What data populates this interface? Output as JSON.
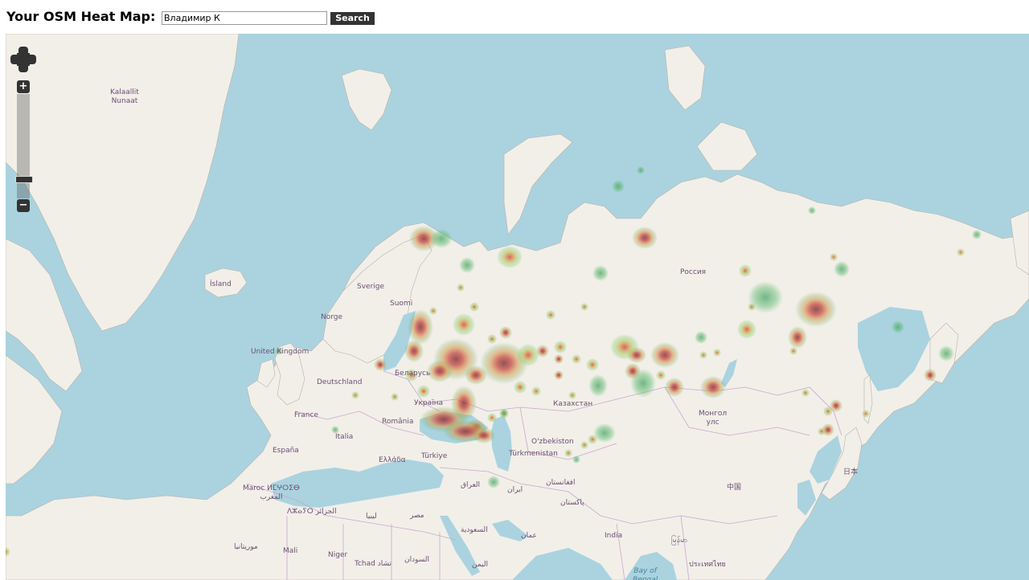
{
  "header": {
    "title": "Your OSM Heat Map:",
    "username_value": "Владимир К",
    "search_label": "Search"
  },
  "map": {
    "controls": {
      "zoom_in_label": "+",
      "zoom_out_label": "−",
      "zoom_level_fraction": 0.85
    },
    "labels": [
      {
        "id": "kalaallit",
        "text": "Kalaallit\nNunaat",
        "type": "country"
      },
      {
        "id": "island",
        "text": "Ísland",
        "type": "country"
      },
      {
        "id": "sverige",
        "text": "Sverige",
        "type": "country"
      },
      {
        "id": "suomi",
        "text": "Suomi",
        "type": "country"
      },
      {
        "id": "norge",
        "text": "Norge",
        "type": "country"
      },
      {
        "id": "uk",
        "text": "United Kingdom",
        "type": "country"
      },
      {
        "id": "deutschland",
        "text": "Deutschland",
        "type": "country"
      },
      {
        "id": "france",
        "text": "France",
        "type": "country"
      },
      {
        "id": "espana",
        "text": "España",
        "type": "country"
      },
      {
        "id": "italia",
        "text": "Italia",
        "type": "country"
      },
      {
        "id": "romania",
        "text": "România",
        "type": "country"
      },
      {
        "id": "ukraina",
        "text": "Україна",
        "type": "country"
      },
      {
        "id": "belarus",
        "text": "Беларусь",
        "type": "country"
      },
      {
        "id": "ellada",
        "text": "Ελλάδα",
        "type": "country"
      },
      {
        "id": "turkiye",
        "text": "Türkiye",
        "type": "country"
      },
      {
        "id": "rossiya",
        "text": "Россия",
        "type": "country"
      },
      {
        "id": "kazakhstan",
        "text": "Казахстан",
        "type": "country"
      },
      {
        "id": "mongolia",
        "text": "Монгол\nулс",
        "type": "country"
      },
      {
        "id": "uzbekistan",
        "text": "O'zbekiston",
        "type": "country"
      },
      {
        "id": "turkmenistan",
        "text": "Türkmenistan",
        "type": "country"
      },
      {
        "id": "iraq",
        "text": "العراق",
        "type": "country"
      },
      {
        "id": "iran",
        "text": "ایران",
        "type": "country"
      },
      {
        "id": "afghanistan",
        "text": "افغانستان",
        "type": "country"
      },
      {
        "id": "pakistan",
        "text": "پاکستان",
        "type": "country"
      },
      {
        "id": "india",
        "text": "India",
        "type": "country"
      },
      {
        "id": "china",
        "text": "中国",
        "type": "country"
      },
      {
        "id": "japan",
        "text": "日本",
        "type": "country"
      },
      {
        "id": "morocco",
        "text": "Maroc ⵍⵎⵖⵔⵉⴱ\nالمغرب",
        "type": "country"
      },
      {
        "id": "algeria",
        "text": "ⴷⵣⴰⵢⵔ الجزائر",
        "type": "country"
      },
      {
        "id": "libya",
        "text": "ليبيا",
        "type": "country"
      },
      {
        "id": "egypt",
        "text": "مصر",
        "type": "country"
      },
      {
        "id": "saudi",
        "text": "السعودية",
        "type": "country"
      },
      {
        "id": "oman",
        "text": "عمان",
        "type": "country"
      },
      {
        "id": "yemen",
        "text": "اليمن",
        "type": "country"
      },
      {
        "id": "mauritania",
        "text": "موريتانيا",
        "type": "country"
      },
      {
        "id": "mali",
        "text": "Mali",
        "type": "country"
      },
      {
        "id": "niger",
        "text": "Niger",
        "type": "country"
      },
      {
        "id": "chad",
        "text": "Tchad تشاد",
        "type": "country"
      },
      {
        "id": "sudan",
        "text": "السودان",
        "type": "country"
      },
      {
        "id": "myanmar",
        "text": "မြန်မာ",
        "type": "country"
      },
      {
        "id": "thailand",
        "text": "ประเทศไทย",
        "type": "country"
      },
      {
        "id": "bengal",
        "text": "Bay of\nBengal",
        "type": "sea"
      }
    ],
    "heat_colors": {
      "outer": "#57b86a",
      "mid": "#d4dc6a",
      "hot": "#c8504a",
      "core": "#7a3a3a"
    }
  }
}
